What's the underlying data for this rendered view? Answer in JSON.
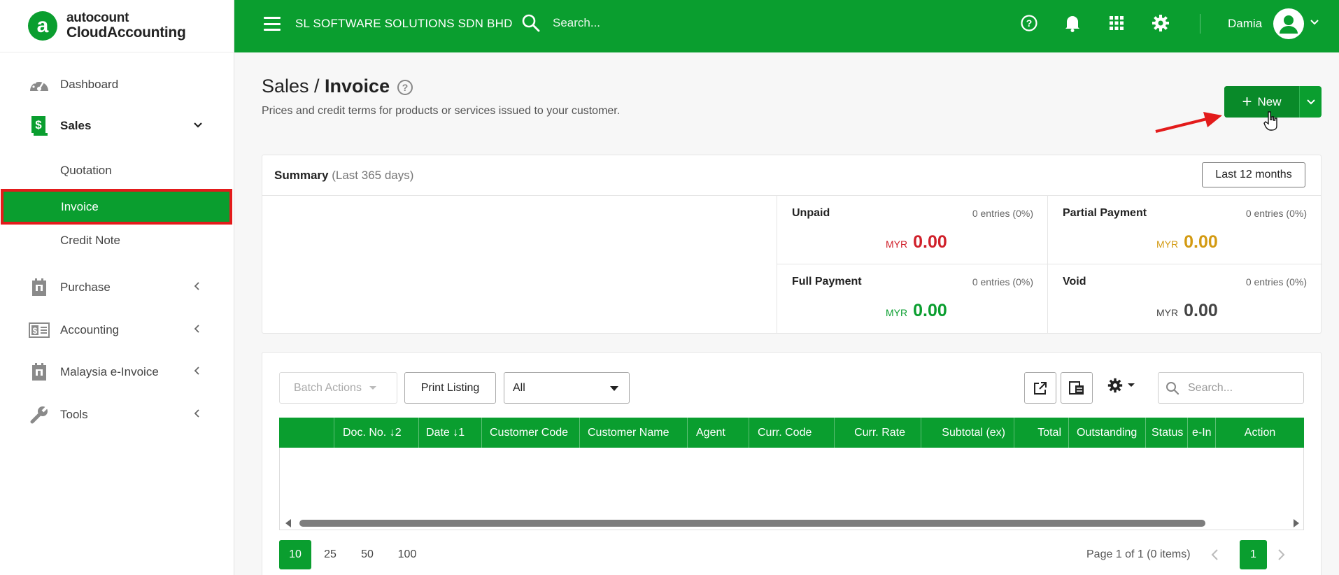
{
  "brand": {
    "line1": "autocount",
    "line2": "CloudAccounting",
    "logo_letter": "a"
  },
  "sidebar": {
    "items": [
      {
        "label": "Dashboard",
        "icon": "gauge-icon"
      },
      {
        "label": "Sales",
        "icon": "dollar-doc-icon"
      },
      {
        "label": "Purchase",
        "icon": "building-icon"
      },
      {
        "label": "Accounting",
        "icon": "money-book-icon"
      },
      {
        "label": "Malaysia e-Invoice",
        "icon": "building-icon"
      },
      {
        "label": "Tools",
        "icon": "wrench-icon"
      }
    ],
    "sales_sub": [
      "Quotation",
      "Invoice",
      "Credit Note"
    ]
  },
  "topbar": {
    "company": "SL SOFTWARE SOLUTIONS SDN BHD",
    "search_placeholder": "Search...",
    "user": "Damia"
  },
  "page": {
    "crumb_parent": "Sales / ",
    "crumb_current": "Invoice",
    "description": "Prices and credit terms for products or services issued to your customer.",
    "new_label": "New",
    "help_glyph": "?"
  },
  "summary": {
    "title": "Summary",
    "range": "(Last 365 days)",
    "period_button": "Last 12 months",
    "cells": [
      {
        "label": "Unpaid",
        "entries": "0 entries (0%)",
        "currency": "MYR",
        "amount": "0.00",
        "color": "#d0202a"
      },
      {
        "label": "Partial Payment",
        "entries": "0 entries (0%)",
        "currency": "MYR",
        "amount": "0.00",
        "color": "#d39a12"
      },
      {
        "label": "Full Payment",
        "entries": "0 entries (0%)",
        "currency": "MYR",
        "amount": "0.00",
        "color": "#0a9e2f"
      },
      {
        "label": "Void",
        "entries": "0 entries (0%)",
        "currency": "MYR",
        "amount": "0.00",
        "color": "#444444"
      }
    ]
  },
  "listing": {
    "batch_actions": "Batch Actions",
    "print_listing": "Print Listing",
    "filter_value": "All",
    "search_placeholder": "Search...",
    "columns": [
      "Doc. No. ↓2",
      "Date ↓1",
      "Customer Code",
      "Customer Name",
      "Agent",
      "Curr. Code",
      "Curr. Rate",
      "Subtotal (ex)",
      "Total",
      "Outstanding",
      "Status",
      "e-In",
      "Action"
    ],
    "page_sizes": [
      "10",
      "25",
      "50",
      "100"
    ],
    "page_info": "Page 1 of 1 (0 items)",
    "current_page": "1"
  },
  "colors": {
    "primary": "#0a9e2f",
    "highlight": "#e31b1b"
  }
}
